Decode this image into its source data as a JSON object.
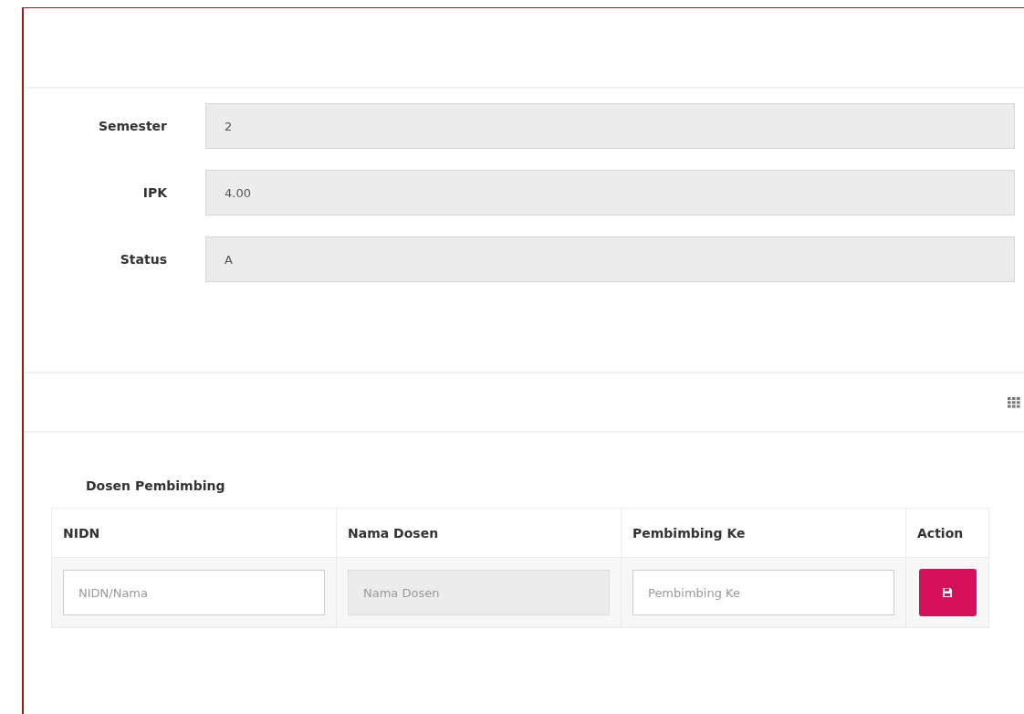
{
  "form": [
    {
      "label": "Semester",
      "value": "2",
      "disabled": true
    },
    {
      "label": "IPK",
      "value": "4.00",
      "disabled": true
    },
    {
      "label": "Status",
      "value": "A",
      "disabled": true
    }
  ],
  "table": {
    "title": "Dosen Pembimbing",
    "columns": [
      "NIDN",
      "Nama Dosen",
      "Pembimbing Ke",
      "Action"
    ],
    "inputs": [
      {
        "placeholder": "NIDN/Nama",
        "disabled": false
      },
      {
        "placeholder": "Nama Dosen",
        "disabled": true
      },
      {
        "placeholder": "Pembimbing Ke",
        "disabled": false
      }
    ]
  }
}
